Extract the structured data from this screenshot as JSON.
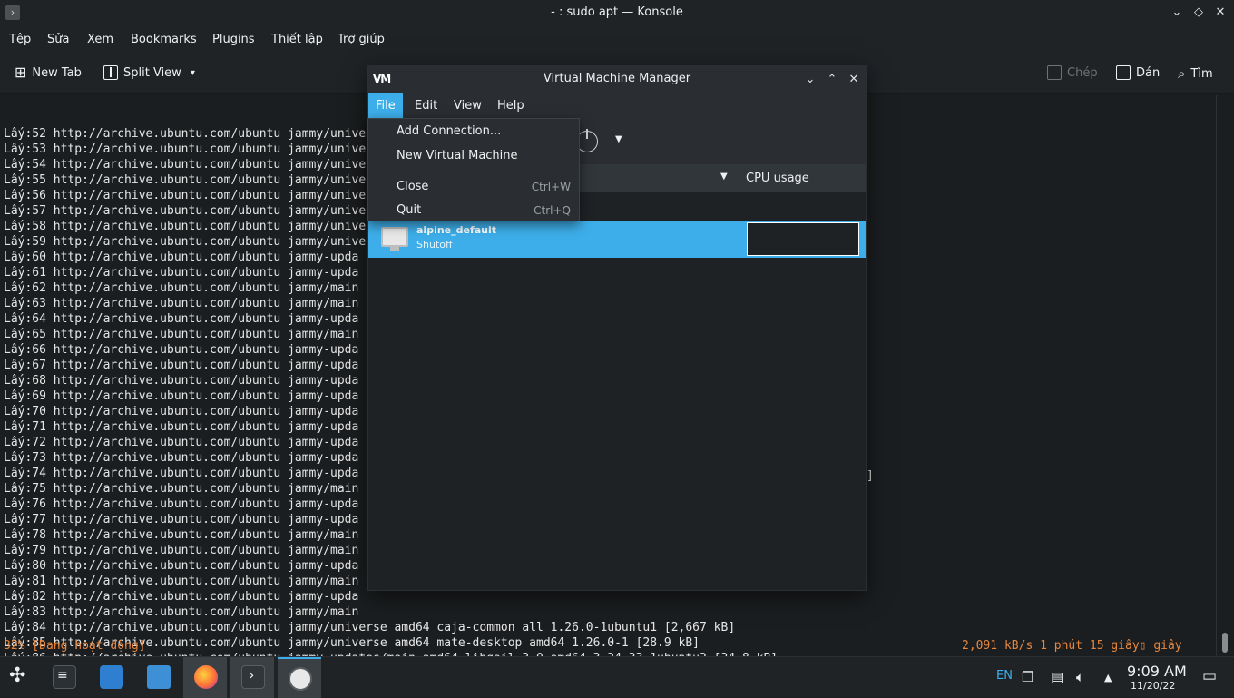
{
  "konsole": {
    "title": "- : sudo apt — Konsole",
    "menus": [
      "Tệp",
      "Sửa",
      "Xem",
      "Bookmarks",
      "Plugins",
      "Thiết lập",
      "Trợ giúp"
    ],
    "toolbar": {
      "new_tab": "New Tab",
      "split_view": "Split View",
      "copy": "Chép",
      "paste": "Dán",
      "find": "Tìm"
    },
    "terminal_lines": [
      "Lấy:52 http://archive.ubuntu.com/ubuntu jammy/unive",
      "Lấy:53 http://archive.ubuntu.com/ubuntu jammy/unive",
      "Lấy:54 http://archive.ubuntu.com/ubuntu jammy/unive",
      "Lấy:55 http://archive.ubuntu.com/ubuntu jammy/unive",
      "Lấy:56 http://archive.ubuntu.com/ubuntu jammy/unive",
      "Lấy:57 http://archive.ubuntu.com/ubuntu jammy/unive",
      "Lấy:58 http://archive.ubuntu.com/ubuntu jammy/unive",
      "Lấy:59 http://archive.ubuntu.com/ubuntu jammy/unive",
      "Lấy:60 http://archive.ubuntu.com/ubuntu jammy-upda",
      "Lấy:61 http://archive.ubuntu.com/ubuntu jammy-upda",
      "Lấy:62 http://archive.ubuntu.com/ubuntu jammy/main",
      "Lấy:63 http://archive.ubuntu.com/ubuntu jammy/main",
      "Lấy:64 http://archive.ubuntu.com/ubuntu jammy-upda",
      "Lấy:65 http://archive.ubuntu.com/ubuntu jammy/main",
      "Lấy:66 http://archive.ubuntu.com/ubuntu jammy-upda",
      "Lấy:67 http://archive.ubuntu.com/ubuntu jammy-upda",
      "Lấy:68 http://archive.ubuntu.com/ubuntu jammy-upda",
      "Lấy:69 http://archive.ubuntu.com/ubuntu jammy-upda",
      "Lấy:70 http://archive.ubuntu.com/ubuntu jammy-upda",
      "Lấy:71 http://archive.ubuntu.com/ubuntu jammy-upda",
      "Lấy:72 http://archive.ubuntu.com/ubuntu jammy-upda",
      "Lấy:73 http://archive.ubuntu.com/ubuntu jammy-upda",
      "Lấy:74 http://archive.ubuntu.com/ubuntu jammy-upda",
      "Lấy:75 http://archive.ubuntu.com/ubuntu jammy/main",
      "Lấy:76 http://archive.ubuntu.com/ubuntu jammy-upda",
      "Lấy:77 http://archive.ubuntu.com/ubuntu jammy-upda",
      "Lấy:78 http://archive.ubuntu.com/ubuntu jammy/main",
      "Lấy:79 http://archive.ubuntu.com/ubuntu jammy/main",
      "Lấy:80 http://archive.ubuntu.com/ubuntu jammy-upda",
      "Lấy:81 http://archive.ubuntu.com/ubuntu jammy/main",
      "Lấy:82 http://archive.ubuntu.com/ubuntu jammy-upda",
      "Lấy:83 http://archive.ubuntu.com/ubuntu jammy/main",
      "Lấy:84 http://archive.ubuntu.com/ubuntu jammy/universe amd64 caja-common all 1.26.0-1ubuntu1 [2,667 kB]",
      "Lấy:85 http://archive.ubuntu.com/ubuntu jammy/universe amd64 mate-desktop amd64 1.26.0-1 [28.9 kB]",
      "Lấy:86 http://archive.ubuntu.com/ubuntu jammy-updates/main amd64 libgail-3-0 amd64 3.24.33-1ubuntu2 [24.8 kB]"
    ],
    "trailing_bracket": "]",
    "status_left": "32% [Đang hoạt động]",
    "status_right": "2,091 kB/s 1 phút 15 giây▯ giây"
  },
  "vmm": {
    "title": "Virtual Machine Manager",
    "logo": "VM",
    "menus": [
      "File",
      "Edit",
      "View",
      "Help"
    ],
    "active_menu": "File",
    "column_cpu": "CPU usage",
    "vm": {
      "name": "alpine_default",
      "state": "Shutoff"
    },
    "file_menu": {
      "items": [
        {
          "label": "Add Connection...",
          "shortcut": ""
        },
        {
          "label": "New Virtual Machine",
          "shortcut": ""
        },
        {
          "label": "Close",
          "shortcut": "Ctrl+W"
        },
        {
          "label": "Quit",
          "shortcut": "Ctrl+Q"
        }
      ]
    }
  },
  "taskbar": {
    "language": "EN",
    "time": "9:09 AM",
    "date": "11/20/22",
    "apps": [
      "application-launcher-icon",
      "settings-icon",
      "store-icon",
      "files-icon",
      "firefox-icon",
      "konsole-icon",
      "virt-manager-icon"
    ]
  },
  "colors": {
    "accent": "#3daee9",
    "terminal_status": "#e7853b",
    "background": "#1b1e20"
  }
}
